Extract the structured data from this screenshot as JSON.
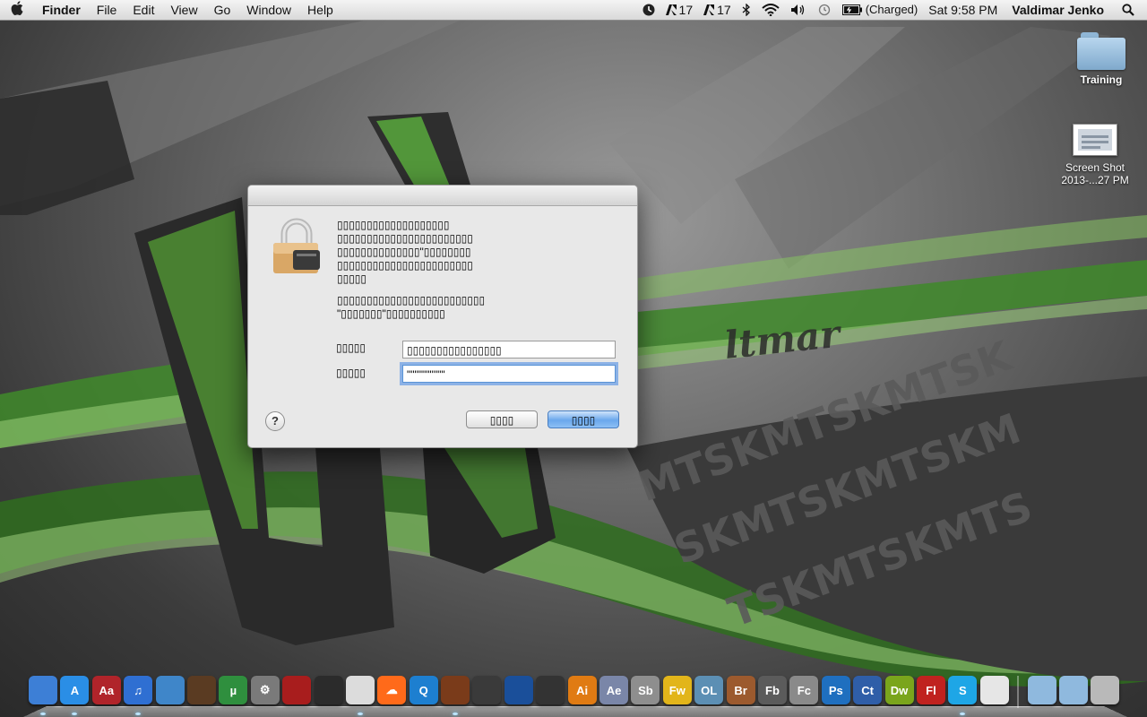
{
  "menubar": {
    "app_name": "Finder",
    "menus": [
      "File",
      "Edit",
      "View",
      "Go",
      "Window",
      "Help"
    ],
    "status": {
      "clock_icon": "time-machine-icon",
      "adobe_1": "17",
      "adobe_2": "17",
      "battery_text": "(Charged)",
      "datetime": "Sat 9:58 PM",
      "user": "Valdimar Jenko"
    }
  },
  "desktop": {
    "folder_label": "Training",
    "screenshot_label_line1": "Screen Shot",
    "screenshot_label_line2": "2013-...27 PM"
  },
  "dialog": {
    "message": "▯▯▯▯▯▯▯▯▯▯▯▯▯▯▯▯▯▯▯\n▯▯▯▯▯▯▯▯▯▯▯▯▯▯▯▯▯▯▯▯▯▯▯\n▯▯▯▯▯▯▯▯▯▯▯▯▯▯\"▯▯▯▯▯▯▯▯\n▯▯▯▯▯▯▯▯▯▯▯▯▯▯▯▯▯▯▯▯▯▯▯\n▯▯▯▯▯",
    "sub_message": "▯▯▯▯▯▯▯▯▯▯▯▯▯▯▯▯▯▯▯▯▯▯▯▯▯\n\"▯▯▯▯▯▯▯\"▯▯▯▯▯▯▯▯▯▯",
    "name_label": "▯▯▯▯▯",
    "name_value": "▯▯▯▯▯▯▯▯▯▯▯▯▯▯▯▯",
    "password_label": "▯▯▯▯▯",
    "password_value": "\"\"\"\"\"\"\"\"\"\"",
    "help_label": "?",
    "cancel_label": "▯▯▯▯",
    "ok_label": "▯▯▯▯"
  },
  "dock": {
    "items": [
      {
        "name": "finder-icon",
        "label": "",
        "color": "#3d7fd6",
        "running": true
      },
      {
        "name": "app-store-icon",
        "label": "A",
        "color": "#2a8ee6",
        "running": true
      },
      {
        "name": "dictionary-icon",
        "label": "Aa",
        "color": "#b0242a",
        "running": false
      },
      {
        "name": "itunes-icon",
        "label": "♫",
        "color": "#2f6fd2",
        "running": true
      },
      {
        "name": "safari-icon",
        "label": "",
        "color": "#3f86c9",
        "running": false
      },
      {
        "name": "garageband-icon",
        "label": "",
        "color": "#5a3b22",
        "running": false
      },
      {
        "name": "utorrent-icon",
        "label": "µ",
        "color": "#2f8f3e",
        "running": false
      },
      {
        "name": "system-preferences-icon",
        "label": "⚙",
        "color": "#7a7a7a",
        "running": false
      },
      {
        "name": "photo-booth-icon",
        "label": "",
        "color": "#a81d1d",
        "running": false
      },
      {
        "name": "movie-reel-icon",
        "label": "",
        "color": "#2b2b2b",
        "running": false
      },
      {
        "name": "preview-icon",
        "label": "",
        "color": "#dcdcdc",
        "running": true
      },
      {
        "name": "soundcloud-icon",
        "label": "☁",
        "color": "#ff6a1a",
        "running": false
      },
      {
        "name": "quicktime-icon",
        "label": "Q",
        "color": "#1d7fd0",
        "running": false
      },
      {
        "name": "wine-icon",
        "label": "",
        "color": "#7a3b1a",
        "running": true
      },
      {
        "name": "facetime-icon",
        "label": "",
        "color": "#3a3a3a",
        "running": false
      },
      {
        "name": "cinema4d-icon",
        "label": "",
        "color": "#1a4f9a",
        "running": false
      },
      {
        "name": "final-cut-icon",
        "label": "",
        "color": "#333333",
        "running": false
      },
      {
        "name": "illustrator-icon",
        "label": "Ai",
        "color": "#e07b13",
        "running": false
      },
      {
        "name": "after-effects-icon",
        "label": "Ae",
        "color": "#7a86a8",
        "running": false
      },
      {
        "name": "soundbooth-icon",
        "label": "Sb",
        "color": "#8e8e8e",
        "running": false
      },
      {
        "name": "fireworks-icon",
        "label": "Fw",
        "color": "#e2b51a",
        "running": false
      },
      {
        "name": "onlocation-icon",
        "label": "OL",
        "color": "#5c8fb4",
        "running": false
      },
      {
        "name": "bridge-icon",
        "label": "Br",
        "color": "#9c5a2e",
        "running": false
      },
      {
        "name": "flash-builder-icon",
        "label": "Fb",
        "color": "#5b5b5b",
        "running": false
      },
      {
        "name": "flash-catalyst-icon",
        "label": "Fc",
        "color": "#8a8a8a",
        "running": false
      },
      {
        "name": "photoshop-icon",
        "label": "Ps",
        "color": "#1f6fbf",
        "running": false
      },
      {
        "name": "contribute-icon",
        "label": "Ct",
        "color": "#2f5ea8",
        "running": false
      },
      {
        "name": "dreamweaver-icon",
        "label": "Dw",
        "color": "#7aa51c",
        "running": false
      },
      {
        "name": "flash-icon",
        "label": "Fl",
        "color": "#c0221f",
        "running": false
      },
      {
        "name": "skype-icon",
        "label": "S",
        "color": "#1ea6e6",
        "running": true
      },
      {
        "name": "textedit-icon",
        "label": "",
        "color": "#e6e6e6",
        "running": false
      }
    ],
    "right_items": [
      {
        "name": "applications-folder-icon",
        "color": "#8fb9de"
      },
      {
        "name": "documents-folder-icon",
        "color": "#8fb9de"
      },
      {
        "name": "trash-icon",
        "color": "#b9b9b9"
      }
    ]
  }
}
